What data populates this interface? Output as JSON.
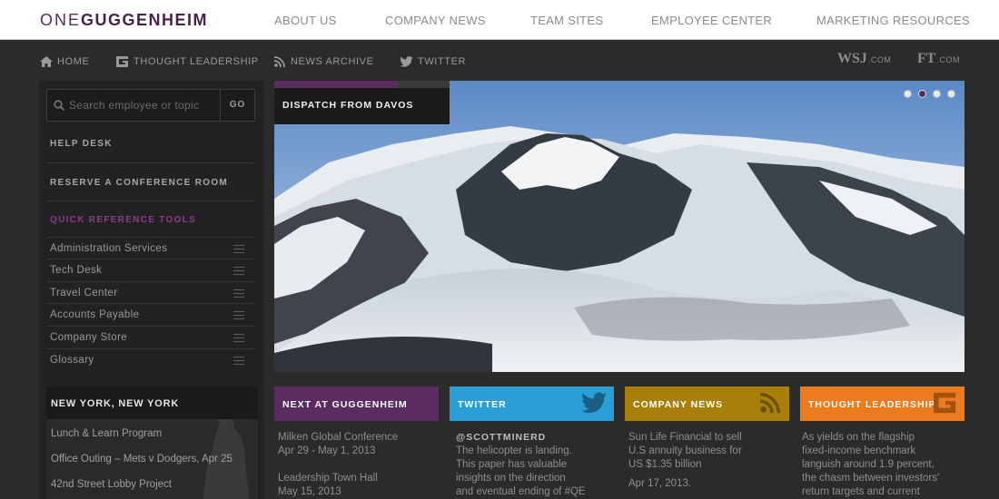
{
  "topbar": {
    "logo_part1": "ONE",
    "logo_part2": "GUGGENHEIM",
    "nav": [
      "ABOUT US",
      "COMPANY NEWS",
      "TEAM SITES",
      "EMPLOYEE CENTER",
      "MARKETING RESOURCES"
    ]
  },
  "secondary_nav": {
    "home": "HOME",
    "thought_leadership": "THOUGHT LEADERSHIP",
    "news_archive": "NEWS ARCHIVE",
    "twitter": "TWITTER",
    "wsj": "WSJ",
    "wsj_suffix": ".COM",
    "ft": "FT",
    "ft_suffix": ".COM"
  },
  "sidebar": {
    "search_placeholder": "Search employee or topic",
    "search_button": "GO",
    "help_desk": "HELP DESK",
    "reserve_room": "RESERVE A CONFERENCE ROOM",
    "quick_reference_title": "QUICK REFERENCE TOOLS",
    "tools": [
      "Administration Services",
      "Tech Desk",
      "Travel Center",
      "Accounts Payable",
      "Company Store",
      "Glossary"
    ],
    "city": {
      "title": "NEW YORK, NEW YORK",
      "items": [
        "Lunch & Learn Program",
        "Office Outing – Mets v Dodgers, Apr 25",
        "42nd Street Lobby Project"
      ]
    }
  },
  "hero": {
    "label": "DISPATCH FROM DAVOS",
    "slide_count": 4,
    "active_slide": 2
  },
  "cards": {
    "next": {
      "title": "NEXT AT GUGGENHEIM",
      "color": "#5a2c5f",
      "event1_title": "Milken Global Conference",
      "event1_date": "Apr 29 - May 1, 2013",
      "event2_title": "Leadership Town Hall",
      "event2_date": "May 15, 2013"
    },
    "twitter": {
      "title": "TWITTER",
      "color": "#2a9fd6",
      "handle": "@SCOTTMINERD",
      "lines": [
        "The helicopter is landing.",
        "This paper has valuable",
        "insights on the direction",
        "and eventual ending of #QE"
      ]
    },
    "company_news": {
      "title": "COMPANY NEWS",
      "color": "#a87f08",
      "lines": [
        "Sun Life Financial to sell",
        "U.S annuity business for",
        "US $1.35 billion"
      ],
      "date": "Apr 17, 2013."
    },
    "thought_leadership": {
      "title": "THOUGHT LEADERSHIP",
      "color": "#ec7a1f",
      "lines": [
        "As yields on the flagship",
        "fixed-income benchmark",
        "languish around 1.9 percent,",
        "the chasm between investors'",
        "return targets and current"
      ]
    }
  }
}
